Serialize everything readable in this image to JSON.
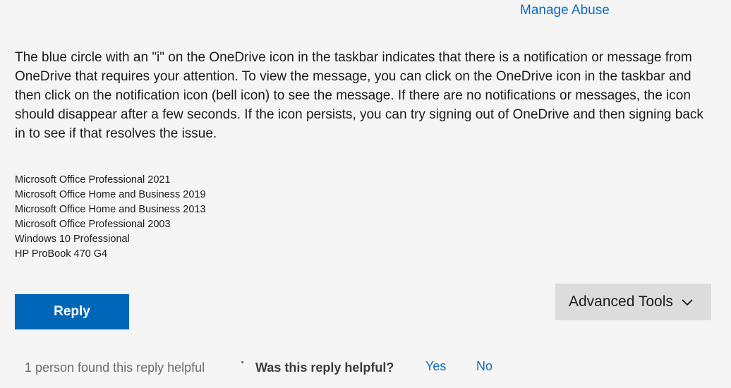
{
  "header": {
    "manage_abuse_label": "Manage Abuse"
  },
  "reply": {
    "body": "The blue circle with an \"i\" on the OneDrive icon in the taskbar indicates that there is a notification or message from OneDrive that requires your attention. To view the message, you can click on the OneDrive icon in the taskbar and then click on the notification icon (bell icon) to see the message. If there are no notifications or messages, the icon should disappear after a few seconds. If the icon persists, you can try signing out of OneDrive and then signing back in to see if that resolves the issue.",
    "signature_lines": [
      "Microsoft Office Professional 2021",
      "Microsoft Office Home and Business 2019",
      "Microsoft Office Home and Business 2013",
      "Microsoft Office Professional 2003",
      "Windows 10 Professional",
      "HP ProBook 470 G4"
    ]
  },
  "actions": {
    "reply_label": "Reply",
    "advanced_tools_label": "Advanced Tools",
    "advanced_tools_icon": "chevron-down-icon"
  },
  "feedback": {
    "helpful_count_text": "1 person found this reply helpful",
    "question": "Was this reply helpful?",
    "yes_label": "Yes",
    "no_label": "No"
  },
  "colors": {
    "link": "#0f6cbd",
    "reply_button": "#0067b8",
    "background": "#f5f5f5",
    "advanced_tools_bg": "#dcdcdc"
  }
}
